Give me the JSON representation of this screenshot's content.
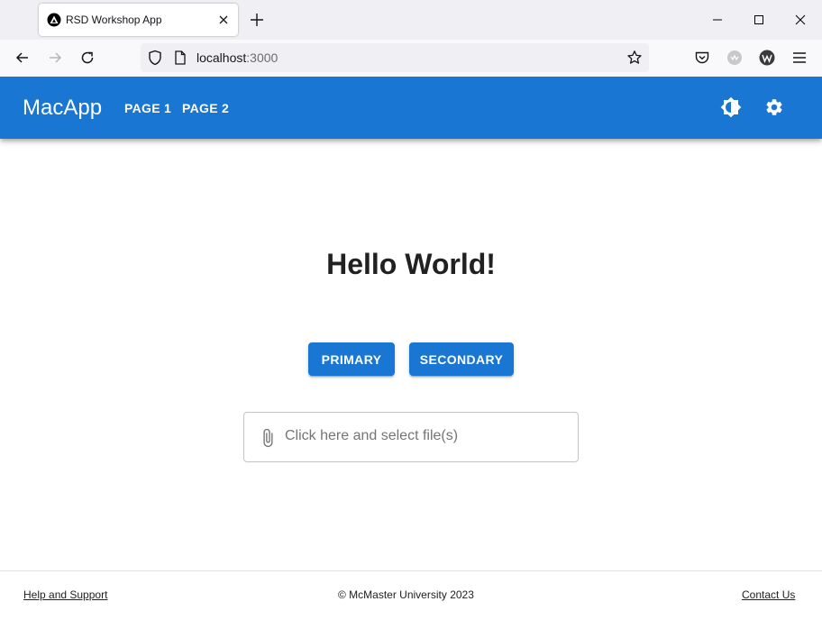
{
  "browser": {
    "tab_title": "RSD Workshop App",
    "url_host": "localhost",
    "url_port": ":3000"
  },
  "app": {
    "title": "MacApp",
    "nav_links": [
      "PAGE 1",
      "PAGE 2"
    ],
    "heading": "Hello World!",
    "primary_button": "PRIMARY",
    "secondary_button": "SECONDARY",
    "file_placeholder": "Click here and select file(s)"
  },
  "footer": {
    "help": "Help and Support",
    "copyright": "© McMaster University 2023",
    "contact": "Contact Us"
  },
  "colors": {
    "primary": "#1976d2",
    "text": "#212121"
  },
  "icons": {
    "theme_toggle": "brightness-icon",
    "settings": "gear-icon",
    "file": "paperclip-icon"
  }
}
